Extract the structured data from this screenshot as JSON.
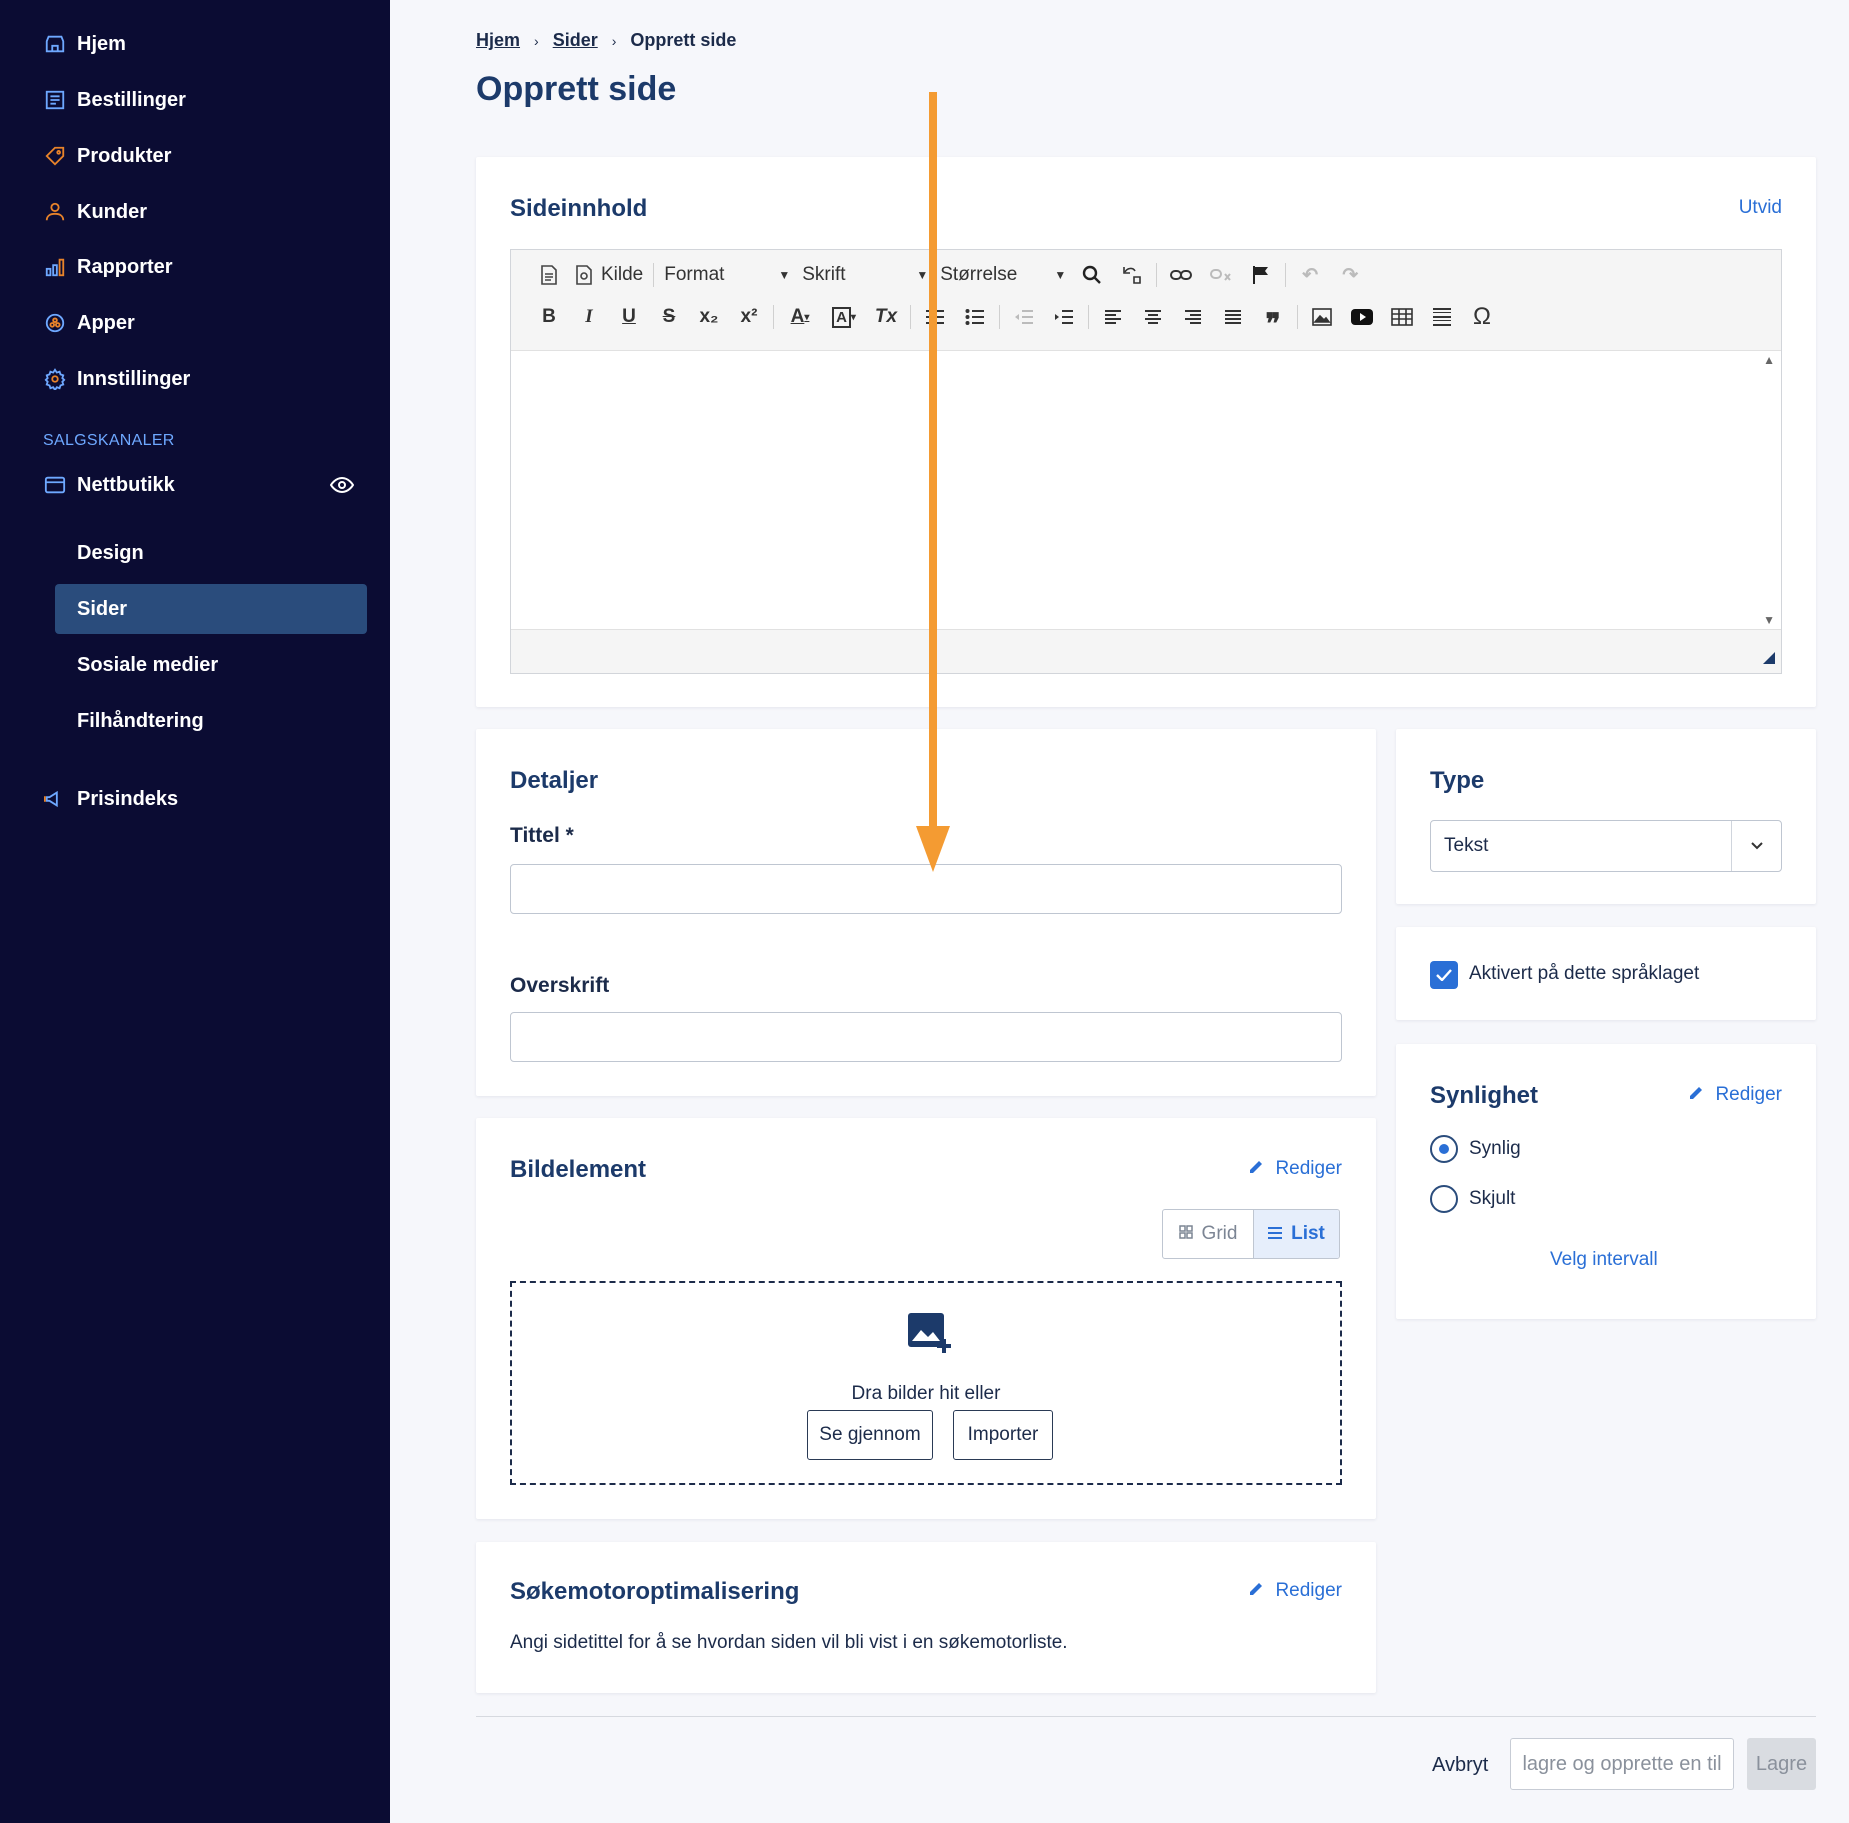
{
  "sidebar": {
    "items": [
      {
        "label": "Hjem",
        "icon": "store-icon"
      },
      {
        "label": "Bestillinger",
        "icon": "orders-icon"
      },
      {
        "label": "Produkter",
        "icon": "tag-icon"
      },
      {
        "label": "Kunder",
        "icon": "user-icon"
      },
      {
        "label": "Rapporter",
        "icon": "bar-chart-icon"
      },
      {
        "label": "Apper",
        "icon": "apps-icon"
      },
      {
        "label": "Innstillinger",
        "icon": "gear-icon"
      }
    ],
    "section_label": "SALGSKANALER",
    "channel": {
      "label": "Nettbutikk",
      "icon": "storefront-icon"
    },
    "sub_items": [
      {
        "label": "Design"
      },
      {
        "label": "Sider"
      },
      {
        "label": "Sosiale medier"
      },
      {
        "label": "Filhåndtering"
      }
    ],
    "extra": {
      "label": "Prisindeks",
      "icon": "megaphone-icon"
    },
    "accent_color": "#e8832a"
  },
  "breadcrumb": {
    "home": "Hjem",
    "pages": "Sider",
    "current": "Opprett side"
  },
  "page_title": "Opprett side",
  "content_card": {
    "title": "Sideinnhold",
    "expand": "Utvid",
    "toolbar": {
      "source": "Kilde",
      "format": "Format",
      "font": "Skrift",
      "size": "Størrelse",
      "bold": "B",
      "italic": "I",
      "underline": "U",
      "strike": "S",
      "subscript": "x₂",
      "superscript": "x²",
      "text_color": "A",
      "bg_color": "A",
      "clear": "Tx",
      "quote": "❞",
      "omega": "Ω"
    }
  },
  "details": {
    "title": "Detaljer",
    "title_label": "Tittel *",
    "title_value": "",
    "heading_label": "Overskrift",
    "heading_value": ""
  },
  "type_card": {
    "title": "Type",
    "selected": "Tekst"
  },
  "activated": {
    "label": "Aktivert på dette språklaget",
    "checked": true
  },
  "visibility": {
    "title": "Synlighet",
    "edit": "Rediger",
    "options": [
      {
        "label": "Synlig",
        "selected": true
      },
      {
        "label": "Skjult",
        "selected": false
      }
    ],
    "interval": "Velg intervall"
  },
  "image_card": {
    "title": "Bildelement",
    "edit": "Rediger",
    "view_grid": "Grid",
    "view_list": "List",
    "drop_text": "Dra bilder hit eller",
    "browse": "Se gjennom",
    "import": "Importer"
  },
  "seo_card": {
    "title": "Søkemotoroptimalisering",
    "edit": "Rediger",
    "hint": "Angi sidetittel for å se hvordan siden vil bli vist i en søkemotorliste."
  },
  "footer": {
    "cancel": "Avbryt",
    "save_and_create": "lagre og opprette en til",
    "save": "Lagre"
  }
}
